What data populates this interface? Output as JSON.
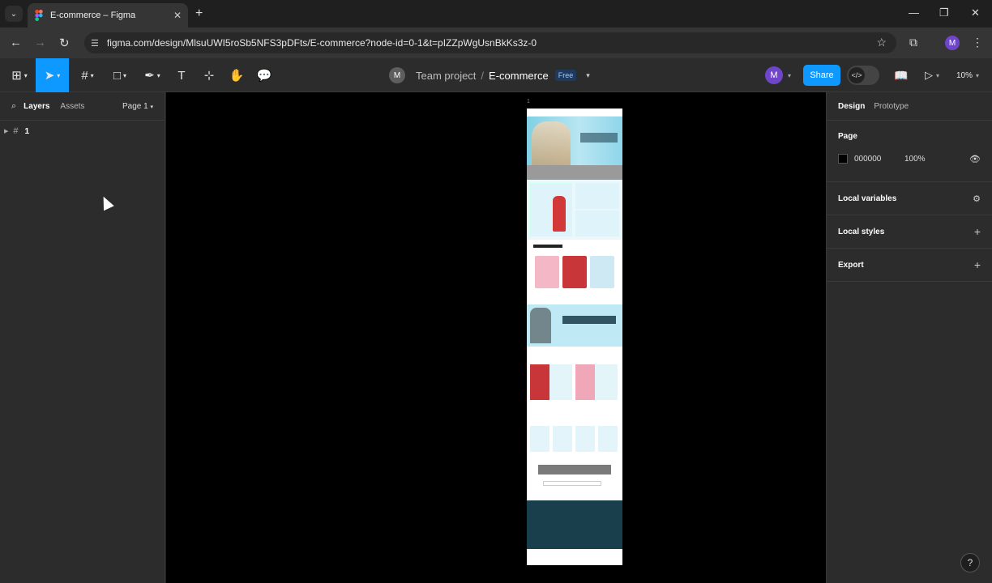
{
  "browser": {
    "tab_title": "E-commerce – Figma",
    "url": "figma.com/design/MlsuUWI5roSb5NFS3pDFts/E-commerce?node-id=0-1&t=pIZZpWgUsnBkKs3z-0",
    "profile_initial": "M"
  },
  "toolbar": {
    "team_avatar": "M",
    "team": "Team project",
    "separator": "/",
    "file": "E-commerce",
    "plan_badge": "Free",
    "user_initial": "M",
    "share_label": "Share",
    "zoom": "10%"
  },
  "left_panel": {
    "tab_layers": "Layers",
    "tab_assets": "Assets",
    "page_selector": "Page 1",
    "layers": [
      {
        "name": "1"
      }
    ]
  },
  "canvas": {
    "frame_label": "1"
  },
  "right_panel": {
    "tab_design": "Design",
    "tab_prototype": "Prototype",
    "page_heading": "Page",
    "page_color": "000000",
    "page_opacity": "100%",
    "local_variables": "Local variables",
    "local_styles": "Local styles",
    "export": "Export"
  },
  "help": "?"
}
